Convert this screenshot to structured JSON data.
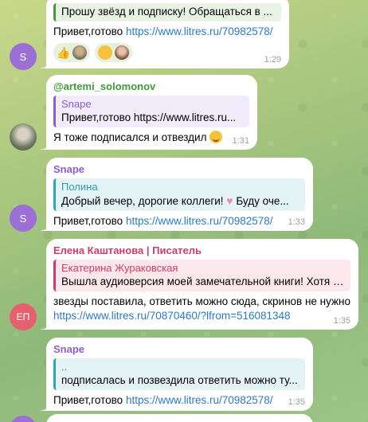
{
  "colors": {
    "snape": "#8e5bd2",
    "artemi": "#3e9b39",
    "elena": "#d23c62",
    "reply_green": "#e8f3e6",
    "reply_purple": "#f1ebfa",
    "reply_teal": "#e4f3f5",
    "reply_pink": "#fbe7ec",
    "link": "#2a79c9"
  },
  "messages": [
    {
      "id": "m1",
      "avatar_initial": "S",
      "reply_text": "Прошу звёзд и подписку! Обращаться в ...",
      "text": "Привет,готово ",
      "link": "https://www.litres.ru/70982578/",
      "reactions": [
        "thumbs-up-icon",
        "avatar-reaction-icon",
        "grin-emoji-icon",
        "avatar-reaction-icon"
      ],
      "time": "1:29"
    },
    {
      "id": "m2",
      "sender": "@artemi_solomonov",
      "reply_name": "Snape",
      "reply_text": "Привет,готово https://www.litres.ru...",
      "text": "Я тоже подписался и отвездил",
      "emoji": "smiling-face-emoji",
      "time": "1:31"
    },
    {
      "id": "m3",
      "sender": "Snape",
      "avatar_initial": "S",
      "reply_name": "Полина",
      "reply_text": "Добрый вечер, дорогие коллеги! ",
      "reply_tail": " Буду оче...",
      "text": "Привет,готово ",
      "link": "https://www.litres.ru/70982578/",
      "time": "1:33"
    },
    {
      "id": "m4",
      "sender": "Елена Каштанова | Писатель",
      "avatar_initial": "ЕП",
      "reply_name": "Екатерина Жураковская",
      "reply_text": "Вышла аудиоверсия моей замечательной книги! Хотя э...",
      "text": "звезды поставила, ответить можно сюда, скринов не нужно",
      "link": "https://www.litres.ru/70870460/?lfrom=516081348",
      "time": "1:35"
    },
    {
      "id": "m5",
      "sender": "Snape",
      "avatar_initial": "S",
      "reply_name": "⁠.⁠.",
      "reply_text": "подписалась и позвездила ответить можно ту...",
      "text": "Привет,готово ",
      "link": "https://www.litres.ru/70982578/",
      "time": "1:35"
    }
  ]
}
